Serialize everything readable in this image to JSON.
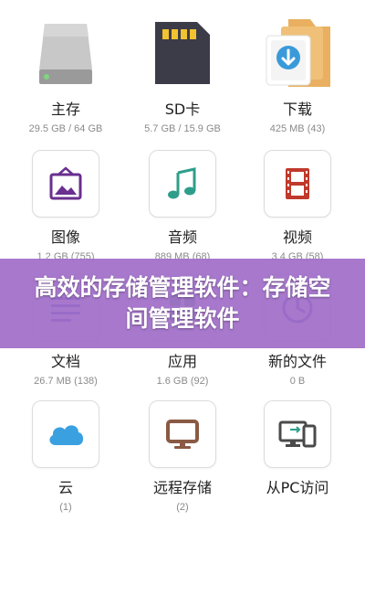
{
  "items": [
    {
      "label": "主存",
      "sub": "29.5 GB / 64 GB",
      "icon": "drive-icon"
    },
    {
      "label": "SD卡",
      "sub": "5.7 GB / 15.9 GB",
      "icon": "sd-card-icon"
    },
    {
      "label": "下载",
      "sub": "425 MB (43)",
      "icon": "download-folder-icon"
    },
    {
      "label": "图像",
      "sub": "1.2 GB (755)",
      "icon": "image-icon"
    },
    {
      "label": "音频",
      "sub": "889 MB (68)",
      "icon": "music-icon"
    },
    {
      "label": "视频",
      "sub": "3.4 GB (58)",
      "icon": "video-icon"
    },
    {
      "label": "文档",
      "sub": "26.7 MB (138)",
      "icon": "document-icon"
    },
    {
      "label": "应用",
      "sub": "1.6 GB (92)",
      "icon": "apps-icon"
    },
    {
      "label": "新的文件",
      "sub": "0 B",
      "icon": "clock-icon"
    },
    {
      "label": "云",
      "sub": "(1)",
      "icon": "cloud-icon"
    },
    {
      "label": "远程存储",
      "sub": "(2)",
      "icon": "monitor-icon"
    },
    {
      "label": "从PC访问",
      "sub": "",
      "icon": "pc-phone-icon"
    }
  ],
  "banner": {
    "text": "高效的存储管理软件：存储空间管理软件"
  },
  "colors": {
    "banner": "#a06ec8",
    "image": "#6a2f8f",
    "music": "#2e9e8a",
    "video": "#c0392b",
    "document": "#4a5cc9",
    "cloud": "#3aa0e0",
    "monitor": "#8a5a44",
    "pc": "#4a4a4a",
    "folder": "#e8b060"
  }
}
